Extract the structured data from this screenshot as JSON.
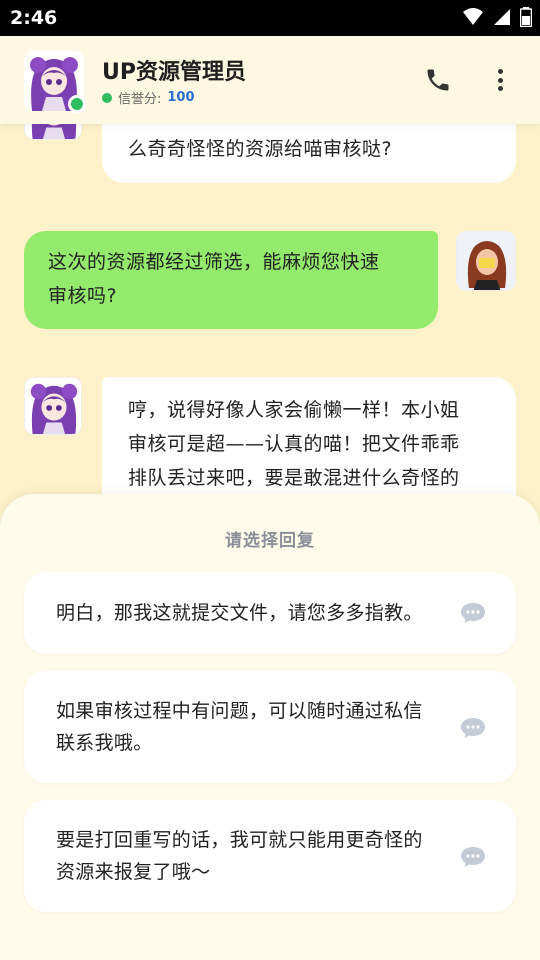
{
  "status": {
    "time": "2:46"
  },
  "header": {
    "title": "UP资源管理员",
    "credit_label": "信誉分:",
    "credit_value": "100"
  },
  "messages": [
    {
      "from": "bot",
      "text": "么奇奇怪怪的资源给喵审核哒?"
    },
    {
      "from": "user",
      "line1": "这次的资源都经过筛选，能麻烦您快速",
      "line2": "审核吗?"
    },
    {
      "from": "bot",
      "line1": "哼，说得好像人家会偷懒一样！本小姐",
      "line2": "审核可是超——认真的喵！把文件乖乖",
      "line3": "排队丢过来吧，要是敢混进什么奇怪的"
    }
  ],
  "sheet": {
    "title": "请选择回复",
    "options": [
      {
        "line1": "明白，那我这就提交文件，请您多多指教。"
      },
      {
        "line1": "如果审核过程中有问题，可以随时通过私信",
        "line2": "联系我哦。"
      },
      {
        "line1": "要是打回重写的话，我可就只能用更奇怪的",
        "line2": "资源来报复了哦～"
      }
    ]
  },
  "colors": {
    "background": "#fdf1c9",
    "user_bubble": "#93ea6c",
    "online": "#2ebd5f",
    "credit_value": "#2a6fd6"
  },
  "icons": [
    "wifi-icon",
    "signal-icon",
    "battery-icon",
    "phone-icon",
    "more-vert-icon",
    "chat-bubble-icon"
  ]
}
